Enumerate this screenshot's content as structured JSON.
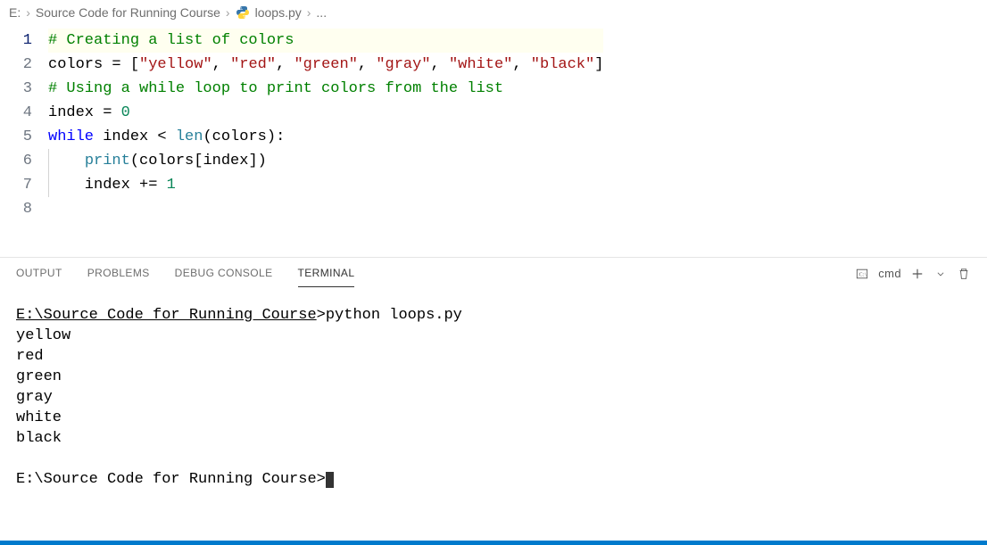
{
  "breadcrumb": {
    "drive": "E:",
    "folder": "Source Code for Running Course",
    "file": "loops.py",
    "trailing": "..."
  },
  "editor": {
    "lines": [
      {
        "n": 1,
        "tokens": [
          [
            "c-comment",
            "# Creating a list of colors"
          ]
        ]
      },
      {
        "n": 2,
        "tokens": [
          [
            "c-default",
            "colors = ["
          ],
          [
            "c-str",
            "\"yellow\""
          ],
          [
            "c-default",
            ", "
          ],
          [
            "c-str",
            "\"red\""
          ],
          [
            "c-default",
            ", "
          ],
          [
            "c-str",
            "\"green\""
          ],
          [
            "c-default",
            ", "
          ],
          [
            "c-str",
            "\"gray\""
          ],
          [
            "c-default",
            ", "
          ],
          [
            "c-str",
            "\"white\""
          ],
          [
            "c-default",
            ", "
          ],
          [
            "c-str",
            "\"black\""
          ],
          [
            "c-default",
            "]"
          ]
        ]
      },
      {
        "n": 3,
        "tokens": [
          [
            "c-default",
            ""
          ]
        ]
      },
      {
        "n": 4,
        "tokens": [
          [
            "c-comment",
            "# Using a while loop to print colors from the list"
          ]
        ]
      },
      {
        "n": 5,
        "tokens": [
          [
            "c-default",
            "index = "
          ],
          [
            "c-num",
            "0"
          ]
        ]
      },
      {
        "n": 6,
        "tokens": [
          [
            "c-kw",
            "while"
          ],
          [
            "c-default",
            " index < "
          ],
          [
            "c-builtin",
            "len"
          ],
          [
            "c-default",
            "(colors):"
          ]
        ]
      },
      {
        "n": 7,
        "indent": 1,
        "tokens": [
          [
            "c-default",
            "    "
          ],
          [
            "c-builtin",
            "print"
          ],
          [
            "c-default",
            "(colors[index])"
          ]
        ]
      },
      {
        "n": 8,
        "indent": 1,
        "tokens": [
          [
            "c-default",
            "    index += "
          ],
          [
            "c-num",
            "1"
          ]
        ]
      }
    ]
  },
  "panel": {
    "tabs": [
      {
        "id": "output",
        "label": "OUTPUT",
        "active": false
      },
      {
        "id": "problems",
        "label": "PROBLEMS",
        "active": false
      },
      {
        "id": "debug",
        "label": "DEBUG CONSOLE",
        "active": false
      },
      {
        "id": "terminal",
        "label": "TERMINAL",
        "active": true
      }
    ],
    "shell_label": "cmd"
  },
  "terminal": {
    "prompt1_path": "E:\\Source Code for Running Course",
    "prompt1_cmd": "python loops.py",
    "output": [
      "yellow",
      "red",
      "green",
      "gray",
      "white",
      "black"
    ],
    "prompt2_path": "E:\\Source Code for Running Course"
  }
}
